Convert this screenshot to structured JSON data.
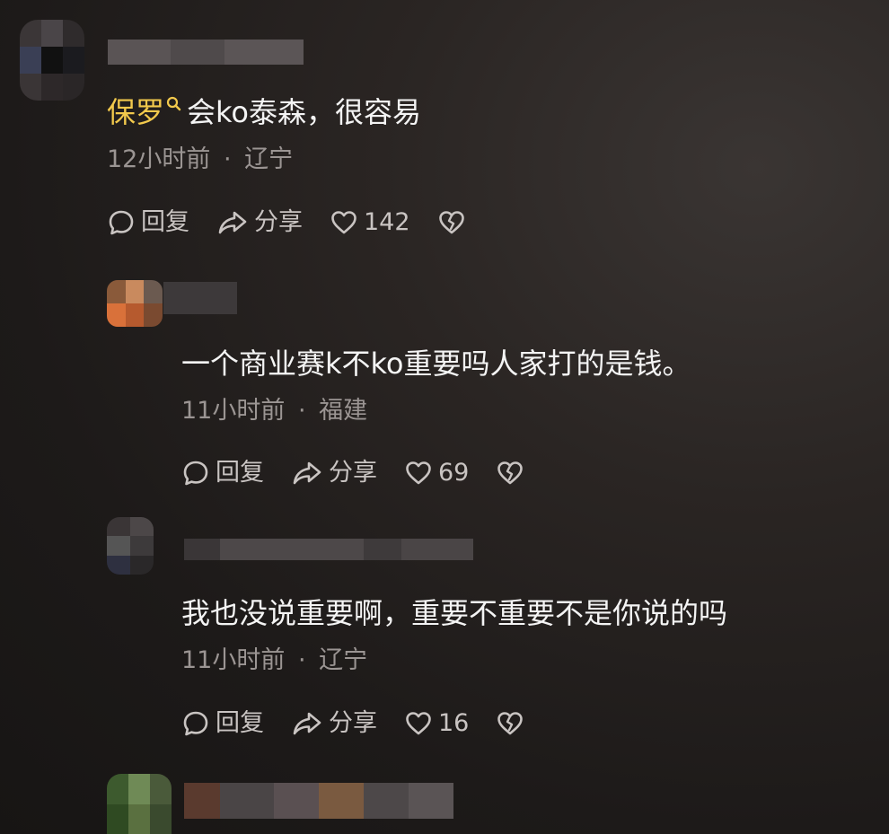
{
  "comments": [
    {
      "username_highlight": "保罗",
      "search_icon": "search-icon",
      "text": "会ko泰森，很容易",
      "time": "12小时前",
      "location": "辽宁",
      "reply_label": "回复",
      "share_label": "分享",
      "likes": "142"
    },
    {
      "text": "一个商业赛k不ko重要吗人家打的是钱。",
      "time": "11小时前",
      "location": "福建",
      "reply_label": "回复",
      "share_label": "分享",
      "likes": "69"
    },
    {
      "text": "我也没说重要啊，重要不重要不是你说的吗",
      "time": "11小时前",
      "location": "辽宁",
      "reply_label": "回复",
      "share_label": "分享",
      "likes": "16"
    }
  ],
  "meta_separator": "·",
  "icons": {
    "reply": "comment-bubble-icon",
    "share": "share-arrow-icon",
    "like": "heart-icon",
    "dislike": "broken-heart-icon"
  },
  "colors": {
    "highlight": "#f2c94c",
    "text": "#f4f4f4",
    "meta": "#9b9593",
    "action": "#c9c4c2"
  }
}
